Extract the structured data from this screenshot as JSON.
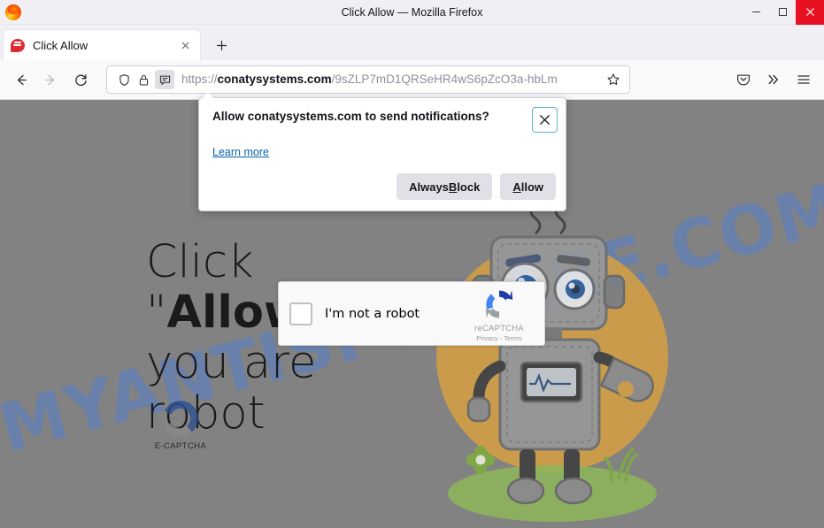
{
  "window": {
    "title": "Click Allow — Mozilla Firefox",
    "minimize_label": "Minimize",
    "maximize_label": "Maximize",
    "close_label": "Close"
  },
  "tabs": [
    {
      "title": "Click Allow",
      "favicon": "speech-bubble-icon",
      "close_label": "×"
    }
  ],
  "newtab": {
    "label": "+"
  },
  "toolbar": {
    "back_label": "Back",
    "forward_label": "Forward",
    "reload_label": "Reload",
    "pocket_label": "Save to Pocket",
    "overflow_label": "»",
    "menu_label": "Open application menu"
  },
  "urlbar": {
    "shield_icon": "shield-icon",
    "lock_icon": "lock-icon",
    "permission_icon": "notification-permission-icon",
    "scheme": "https://",
    "host": "conatysystems.com",
    "path": "/9sZLP7mD1QRSeHR4wS6pZcO3a-hbLm",
    "full_url": "https://conatysystems.com/9sZLP7mD1QRSeHR4wS6pZcO3a-hbLm",
    "bookmark_icon": "star-icon"
  },
  "permission_popup": {
    "title": "Allow conatysystems.com to send notifications?",
    "learn_more": "Learn more",
    "always_block": "Always Block",
    "always_block_pre": "Always ",
    "always_block_key": "B",
    "always_block_post": "lock",
    "allow_key": "A",
    "allow_post": "llow",
    "allow": "Allow",
    "close_icon": "close-icon",
    "accent_color": "#62b3d4",
    "link_color": "#0a63a8"
  },
  "page": {
    "background_color": "#828282",
    "watermark": "MYANTISPYWARE.COM",
    "watermark_color": "#5a7fc4",
    "heading_pre": "Click \"",
    "heading_bold": "Allow",
    "heading_post": "\" if you are robot",
    "ecaptcha": {
      "label": "E-CAPTCHA",
      "logo_icon": "ecaptcha-c-logo-icon",
      "blue": "#2d4f91",
      "gray": "#8a8a8a"
    },
    "recaptcha": {
      "checkbox_label": "I'm not a robot",
      "brand": "reCAPTCHA",
      "legal": "Privacy - Terms",
      "logo_icon": "recaptcha-logo-icon",
      "checked": false
    },
    "robot_illustration": {
      "name": "robot-mascot-image",
      "circle_color": "#d6a042",
      "body_color": "#8d8d8d",
      "grass_color": "#7ab648"
    }
  }
}
